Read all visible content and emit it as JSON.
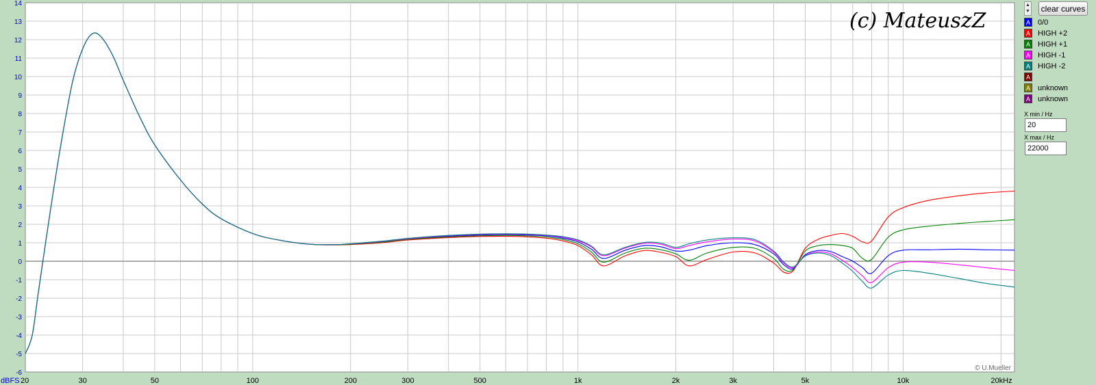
{
  "watermark": "(c) MateuszZ",
  "credit": "© U.Mueller",
  "y_unit_label": "dBFS",
  "x_unit_label": "20kHz",
  "controls": {
    "clear_label": "clear curves",
    "xmin_label": "X min / Hz",
    "xmin_value": "20",
    "xmax_label": "X max / Hz",
    "xmax_value": "22000",
    "legend_glyph": "A"
  },
  "legend": [
    {
      "label": "0/0",
      "color": "#0000ff"
    },
    {
      "label": "HIGH +2",
      "color": "#ff0000"
    },
    {
      "label": "HIGH +1",
      "color": "#008000"
    },
    {
      "label": "HIGH -1",
      "color": "#ff00ff"
    },
    {
      "label": "HIGH -2",
      "color": "#008080"
    },
    {
      "label": "",
      "color": "#800000"
    },
    {
      "label": "unknown",
      "color": "#808000"
    },
    {
      "label": "unknown",
      "color": "#800080"
    }
  ],
  "chart_data": {
    "type": "line",
    "x_scale": "log",
    "xlim": [
      20,
      22000
    ],
    "ylim": [
      -6,
      14
    ],
    "grid": true,
    "background": "#ffffff",
    "grid_color": "#c8c8c8",
    "x_ticks": [
      {
        "v": 30,
        "label": "30"
      },
      {
        "v": 50,
        "label": "50"
      },
      {
        "v": 100,
        "label": "100"
      },
      {
        "v": 200,
        "label": "200"
      },
      {
        "v": 300,
        "label": "300"
      },
      {
        "v": 500,
        "label": "500"
      },
      {
        "v": 1000,
        "label": "1k"
      },
      {
        "v": 2000,
        "label": "2k"
      },
      {
        "v": 3000,
        "label": "3k"
      },
      {
        "v": 5000,
        "label": "5k"
      },
      {
        "v": 10000,
        "label": "10k"
      }
    ],
    "x_start_label": "20",
    "y_ticks": [
      "14",
      "13",
      "12",
      "11",
      "10",
      "9",
      "8",
      "7",
      "6",
      "5",
      "4",
      "3",
      "2",
      "1",
      "0",
      "-1",
      "-2",
      "-3",
      "-4",
      "-5",
      "-6"
    ],
    "series": [
      {
        "name": "0/0",
        "color": "#0000ff",
        "x": [
          20,
          21,
          22,
          24,
          26,
          28,
          30,
          32,
          34,
          37,
          40,
          45,
          50,
          60,
          70,
          80,
          100,
          120,
          150,
          180,
          200,
          250,
          300,
          400,
          500,
          600,
          700,
          800,
          900,
          1000,
          1100,
          1200,
          1400,
          1600,
          1800,
          2000,
          2200,
          2500,
          3000,
          3500,
          4000,
          4300,
          4600,
          5000,
          5500,
          6000,
          6500,
          7000,
          7500,
          8000,
          9000,
          10000,
          12000,
          15000,
          18000,
          22000
        ],
        "y": [
          -5,
          -4,
          -1.5,
          3,
          6.8,
          9.8,
          11.5,
          12.3,
          12.2,
          11.2,
          9.8,
          7.8,
          6.3,
          4.4,
          3.1,
          2.3,
          1.5,
          1.15,
          0.92,
          0.9,
          0.93,
          1.05,
          1.2,
          1.35,
          1.42,
          1.44,
          1.42,
          1.37,
          1.25,
          1.05,
          0.65,
          0.15,
          0.6,
          0.85,
          0.78,
          0.55,
          0.6,
          0.85,
          1,
          0.9,
          0.4,
          -0.2,
          -0.4,
          0.35,
          0.58,
          0.52,
          0.25,
          0,
          -0.35,
          -0.65,
          0.3,
          0.6,
          0.62,
          0.65,
          0.62,
          0.6
        ]
      },
      {
        "name": "HIGH +2",
        "color": "#ff0000",
        "x": [
          20,
          21,
          22,
          24,
          26,
          28,
          30,
          32,
          34,
          37,
          40,
          45,
          50,
          60,
          70,
          80,
          100,
          120,
          150,
          180,
          200,
          250,
          300,
          400,
          500,
          600,
          700,
          800,
          900,
          1000,
          1100,
          1200,
          1400,
          1600,
          1800,
          2000,
          2200,
          2500,
          3000,
          3500,
          4000,
          4300,
          4600,
          5000,
          5500,
          6000,
          6500,
          7000,
          7500,
          8000,
          9000,
          10000,
          12000,
          15000,
          18000,
          22000
        ],
        "y": [
          -5,
          -4,
          -1.5,
          3,
          6.8,
          9.8,
          11.5,
          12.3,
          12.2,
          11.2,
          9.8,
          7.8,
          6.3,
          4.4,
          3.1,
          2.3,
          1.5,
          1.15,
          0.92,
          0.88,
          0.9,
          1,
          1.15,
          1.28,
          1.34,
          1.35,
          1.32,
          1.25,
          1.1,
          0.85,
          0.35,
          -0.25,
          0.3,
          0.58,
          0.48,
          0.25,
          -0.25,
          0.1,
          0.5,
          0.45,
          -0.1,
          -0.6,
          -0.5,
          0.7,
          1.2,
          1.4,
          1.5,
          1.35,
          1.05,
          1.1,
          2.4,
          2.9,
          3.3,
          3.55,
          3.7,
          3.8
        ]
      },
      {
        "name": "HIGH +1",
        "color": "#008000",
        "x": [
          20,
          21,
          22,
          24,
          26,
          28,
          30,
          32,
          34,
          37,
          40,
          45,
          50,
          60,
          70,
          80,
          100,
          120,
          150,
          180,
          200,
          250,
          300,
          400,
          500,
          600,
          700,
          800,
          900,
          1000,
          1100,
          1200,
          1400,
          1600,
          1800,
          2000,
          2200,
          2500,
          3000,
          3500,
          4000,
          4300,
          4600,
          5000,
          5500,
          6000,
          6500,
          7000,
          7500,
          8000,
          9000,
          10000,
          12000,
          15000,
          18000,
          22000
        ],
        "y": [
          -5,
          -4,
          -1.5,
          3,
          6.8,
          9.8,
          11.5,
          12.3,
          12.2,
          11.2,
          9.8,
          7.8,
          6.3,
          4.4,
          3.1,
          2.3,
          1.5,
          1.15,
          0.92,
          0.89,
          0.92,
          1.03,
          1.18,
          1.32,
          1.38,
          1.4,
          1.37,
          1.31,
          1.18,
          0.95,
          0.5,
          -0.05,
          0.45,
          0.7,
          0.62,
          0.4,
          0.05,
          0.45,
          0.75,
          0.7,
          0.15,
          -0.45,
          -0.45,
          0.55,
          0.85,
          0.9,
          0.85,
          0.7,
          0.15,
          0.1,
          1.3,
          1.7,
          1.9,
          2.05,
          2.15,
          2.25
        ]
      },
      {
        "name": "HIGH -1",
        "color": "#ff00ff",
        "x": [
          20,
          21,
          22,
          24,
          26,
          28,
          30,
          32,
          34,
          37,
          40,
          45,
          50,
          60,
          70,
          80,
          100,
          120,
          150,
          180,
          200,
          250,
          300,
          400,
          500,
          600,
          700,
          800,
          900,
          1000,
          1100,
          1200,
          1400,
          1600,
          1800,
          2000,
          2200,
          2500,
          3000,
          3500,
          4000,
          4300,
          4600,
          5000,
          5500,
          6000,
          6500,
          7000,
          7500,
          8000,
          9000,
          10000,
          12000,
          15000,
          18000,
          22000
        ],
        "y": [
          -5,
          -4,
          -1.5,
          3,
          6.8,
          9.8,
          11.5,
          12.3,
          12.2,
          11.2,
          9.8,
          7.8,
          6.3,
          4.4,
          3.1,
          2.3,
          1.5,
          1.15,
          0.92,
          0.9,
          0.94,
          1.07,
          1.22,
          1.38,
          1.45,
          1.47,
          1.45,
          1.4,
          1.3,
          1.12,
          0.78,
          0.3,
          0.72,
          0.97,
          0.92,
          0.68,
          0.85,
          1.05,
          1.2,
          1.1,
          0.5,
          -0.1,
          -0.35,
          0.3,
          0.5,
          0.4,
          0.05,
          -0.35,
          -0.8,
          -1.15,
          -0.35,
          -0.05,
          -0.05,
          -0.2,
          -0.35,
          -0.5
        ]
      },
      {
        "name": "HIGH -2",
        "color": "#008080",
        "x": [
          20,
          21,
          22,
          24,
          26,
          28,
          30,
          32,
          34,
          37,
          40,
          45,
          50,
          60,
          70,
          80,
          100,
          120,
          150,
          180,
          200,
          250,
          300,
          400,
          500,
          600,
          700,
          800,
          900,
          1000,
          1100,
          1200,
          1400,
          1600,
          1800,
          2000,
          2200,
          2500,
          3000,
          3500,
          4000,
          4300,
          4600,
          5000,
          5500,
          6000,
          6500,
          7000,
          7500,
          8000,
          9000,
          10000,
          12000,
          15000,
          18000,
          22000
        ],
        "y": [
          -5,
          -4,
          -1.5,
          3,
          6.8,
          9.8,
          11.5,
          12.3,
          12.2,
          11.2,
          9.8,
          7.8,
          6.3,
          4.4,
          3.1,
          2.3,
          1.5,
          1.15,
          0.92,
          0.9,
          0.95,
          1.09,
          1.24,
          1.4,
          1.47,
          1.49,
          1.47,
          1.42,
          1.33,
          1.16,
          0.82,
          0.35,
          0.76,
          1.02,
          0.98,
          0.75,
          0.95,
          1.15,
          1.27,
          1.17,
          0.55,
          -0.05,
          -0.3,
          0.28,
          0.45,
          0.3,
          -0.1,
          -0.55,
          -1.1,
          -1.45,
          -0.75,
          -0.5,
          -0.65,
          -0.95,
          -1.2,
          -1.4
        ]
      }
    ]
  }
}
